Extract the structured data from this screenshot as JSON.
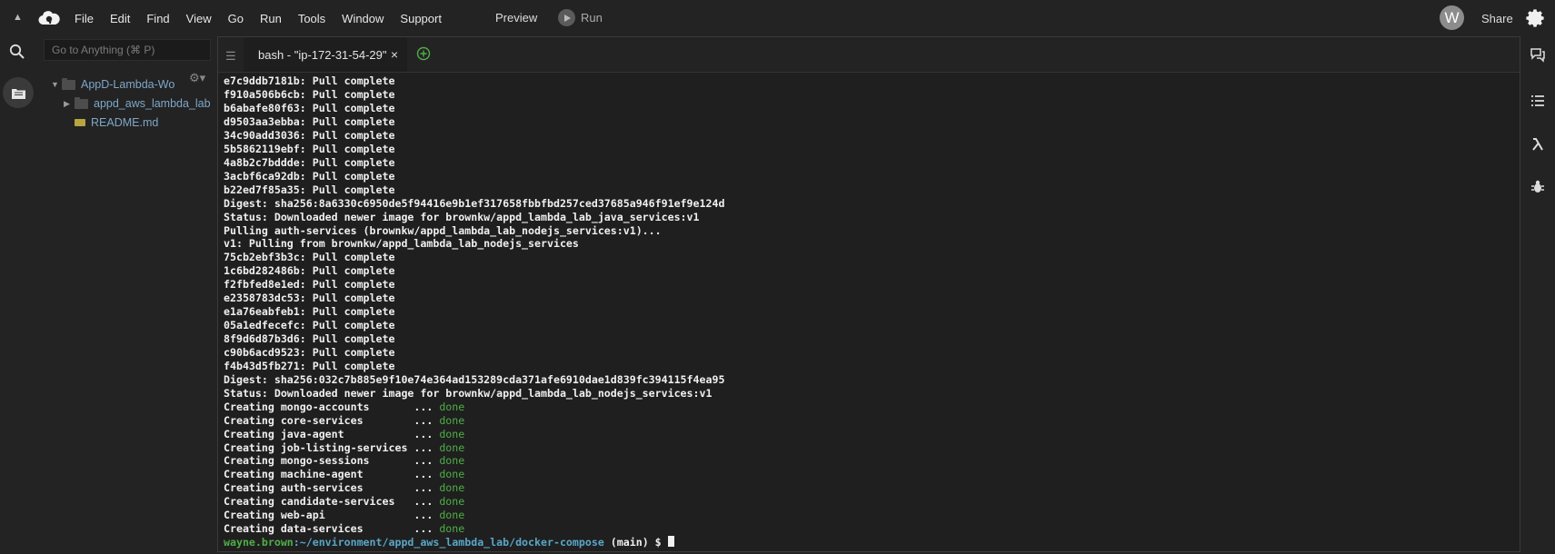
{
  "menubar": {
    "items": [
      "File",
      "Edit",
      "Find",
      "View",
      "Go",
      "Run",
      "Tools",
      "Window",
      "Support"
    ],
    "preview_label": "Preview",
    "run_label": "Run",
    "avatar_letter": "W",
    "share_label": "Share"
  },
  "sidebar": {
    "goto_placeholder": "Go to Anything (⌘ P)",
    "tree": {
      "root": "AppD-Lambda-Wo",
      "folder": "appd_aws_lambda_lab",
      "file": "README.md"
    }
  },
  "tab": {
    "title": "bash - \"ip-172-31-54-29\"",
    "close": "×"
  },
  "terminal": {
    "lines": [
      "e7c9ddb7181b: Pull complete",
      "f910a506b6cb: Pull complete",
      "b6abafe80f63: Pull complete",
      "d9503aa3ebba: Pull complete",
      "34c90add3036: Pull complete",
      "5b5862119ebf: Pull complete",
      "4a8b2c7bddde: Pull complete",
      "3acbf6ca92db: Pull complete",
      "b22ed7f85a35: Pull complete",
      "Digest: sha256:8a6330c6950de5f94416e9b1ef317658fbbfbd257ced37685a946f91ef9e124d",
      "Status: Downloaded newer image for brownkw/appd_lambda_lab_java_services:v1",
      "Pulling auth-services (brownkw/appd_lambda_lab_nodejs_services:v1)...",
      "v1: Pulling from brownkw/appd_lambda_lab_nodejs_services",
      "75cb2ebf3b3c: Pull complete",
      "1c6bd282486b: Pull complete",
      "f2fbfed8e1ed: Pull complete",
      "e2358783dc53: Pull complete",
      "e1a76eabfeb1: Pull complete",
      "05a1edfecefc: Pull complete",
      "8f9d6d87b3d6: Pull complete",
      "c90b6acd9523: Pull complete",
      "f4b43d5fb271: Pull complete",
      "Digest: sha256:032c7b885e9f10e74e364ad153289cda371afe6910dae1d839fc394115f4ea95",
      "Status: Downloaded newer image for brownkw/appd_lambda_lab_nodejs_services:v1"
    ],
    "creating": [
      {
        "prefix": "Creating mongo-accounts       ... ",
        "status": "done"
      },
      {
        "prefix": "Creating core-services        ... ",
        "status": "done"
      },
      {
        "prefix": "Creating java-agent           ... ",
        "status": "done"
      },
      {
        "prefix": "Creating job-listing-services ... ",
        "status": "done"
      },
      {
        "prefix": "Creating mongo-sessions       ... ",
        "status": "done"
      },
      {
        "prefix": "Creating machine-agent        ... ",
        "status": "done"
      },
      {
        "prefix": "Creating auth-services        ... ",
        "status": "done"
      },
      {
        "prefix": "Creating candidate-services   ... ",
        "status": "done"
      },
      {
        "prefix": "Creating web-api              ... ",
        "status": "done"
      },
      {
        "prefix": "Creating data-services        ... ",
        "status": "done"
      }
    ],
    "prompt": {
      "user": "wayne.brown",
      "path": ":~/environment/appd_aws_lambda_lab/docker-compose",
      "branch": " (main) $ "
    }
  },
  "colors": {
    "background": "#232323",
    "terminal_bg": "#1f1f1f",
    "done_green": "#4fae46",
    "path_blue": "#5aa6c8",
    "tree_text": "#7fa6c9"
  }
}
